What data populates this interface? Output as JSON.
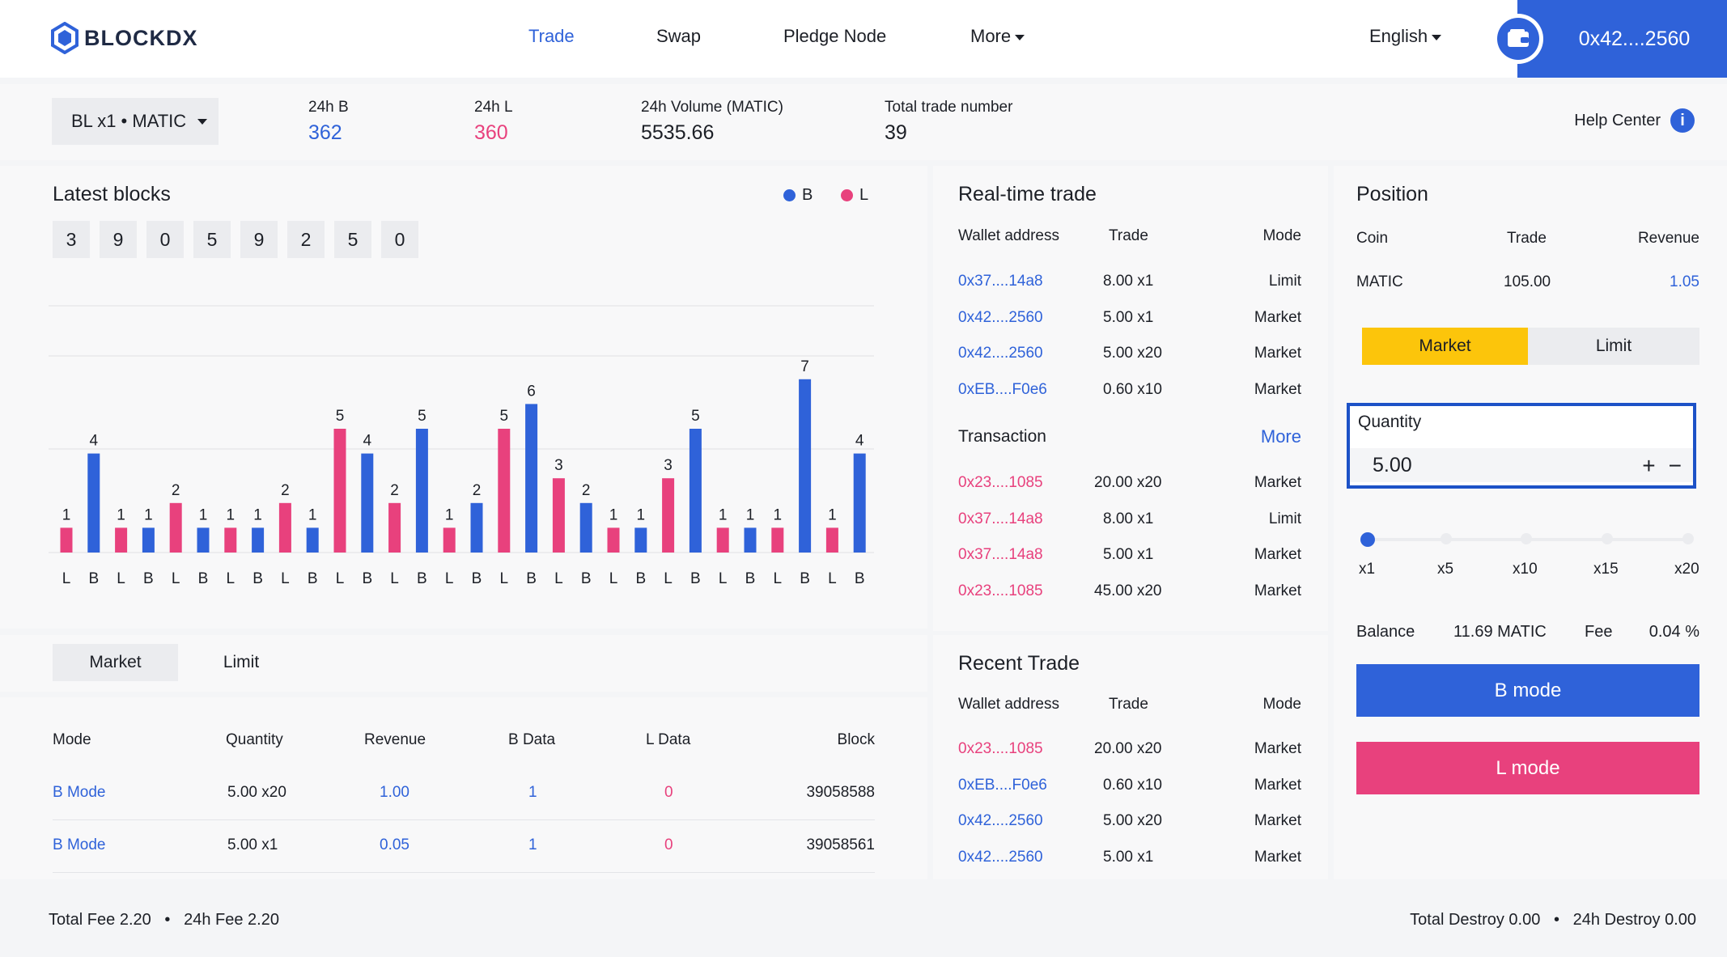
{
  "header": {
    "logo_text": "BLOCKDX",
    "nav": [
      "Trade",
      "Swap",
      "Pledge Node",
      "More"
    ],
    "language": "English",
    "wallet_address": "0x42....2560"
  },
  "stats": {
    "market": "BL x1 • MATIC",
    "b24": {
      "label": "24h B",
      "value": "362"
    },
    "l24": {
      "label": "24h L",
      "value": "360"
    },
    "volume": {
      "label": "24h Volume (MATIC)",
      "value": "5535.66"
    },
    "trades": {
      "label": "Total trade number",
      "value": "39"
    },
    "help": "Help Center"
  },
  "latest_blocks": {
    "title": "Latest blocks",
    "digits": [
      "3",
      "9",
      "0",
      "5",
      "9",
      "2",
      "5",
      "0"
    ],
    "legend_b": "B",
    "legend_l": "L"
  },
  "chart_data": {
    "type": "bar",
    "categories": [
      "L",
      "B",
      "L",
      "B",
      "L",
      "B",
      "L",
      "B",
      "L",
      "B",
      "L",
      "B",
      "L",
      "B",
      "L",
      "B",
      "L",
      "B",
      "L",
      "B",
      "L",
      "B",
      "L",
      "B",
      "L",
      "B",
      "L",
      "B",
      "L",
      "B"
    ],
    "values": [
      1,
      4,
      1,
      1,
      2,
      1,
      1,
      1,
      2,
      1,
      5,
      4,
      2,
      5,
      1,
      2,
      5,
      6,
      3,
      2,
      1,
      1,
      3,
      5,
      1,
      1,
      1,
      7,
      1,
      4
    ],
    "colors": {
      "B": "#2f62d9",
      "L": "#e8417d"
    },
    "ylim": [
      0,
      10
    ]
  },
  "orders": {
    "tabs": [
      "Market",
      "Limit"
    ],
    "headers": [
      "Mode",
      "Quantity",
      "Revenue",
      "B Data",
      "L Data",
      "Block"
    ],
    "rows": [
      [
        "B Mode",
        "5.00 x20",
        "1.00",
        "1",
        "0",
        "39058588"
      ],
      [
        "B Mode",
        "5.00 x1",
        "0.05",
        "1",
        "0",
        "39058561"
      ]
    ]
  },
  "realtime": {
    "title": "Real-time trade",
    "headers": [
      "Wallet address",
      "Trade",
      "Mode"
    ],
    "rows": [
      [
        "0x37....14a8",
        "8.00 x1",
        "Limit"
      ],
      [
        "0x42....2560",
        "5.00 x1",
        "Market"
      ],
      [
        "0x42....2560",
        "5.00 x20",
        "Market"
      ],
      [
        "0xEB....F0e6",
        "0.60 x10",
        "Market"
      ]
    ],
    "transaction_title": "Transaction",
    "more": "More",
    "tx_rows": [
      [
        "0x23....1085",
        "20.00 x20",
        "Market"
      ],
      [
        "0x37....14a8",
        "8.00 x1",
        "Limit"
      ],
      [
        "0x37....14a8",
        "5.00 x1",
        "Market"
      ],
      [
        "0x23....1085",
        "45.00 x20",
        "Market"
      ]
    ]
  },
  "recent": {
    "title": "Recent Trade",
    "headers": [
      "Wallet address",
      "Trade",
      "Mode"
    ],
    "rows": [
      [
        "0x23....1085",
        "20.00 x20",
        "Market"
      ],
      [
        "0xEB....F0e6",
        "0.60 x10",
        "Market"
      ],
      [
        "0x42....2560",
        "5.00 x20",
        "Market"
      ],
      [
        "0x42....2560",
        "5.00 x1",
        "Market"
      ]
    ]
  },
  "position": {
    "title": "Position",
    "headers": [
      "Coin",
      "Trade",
      "Revenue"
    ],
    "row": [
      "MATIC",
      "105.00",
      "1.05"
    ],
    "tabs": [
      "Market",
      "Limit"
    ],
    "quantity_label": "Quantity",
    "quantity_value": "5.00",
    "leverage": [
      "x1",
      "x5",
      "x10",
      "x15",
      "x20"
    ],
    "balance_label": "Balance",
    "balance_value": "11.69 MATIC",
    "fee_label": "Fee",
    "fee_value": "0.04 %",
    "b_mode": "B mode",
    "l_mode": "L mode"
  },
  "footer": {
    "left": "Total Fee 2.20   •   24h Fee 2.20",
    "right": "Total Destroy 0.00   •   24h Destroy 0.00"
  }
}
